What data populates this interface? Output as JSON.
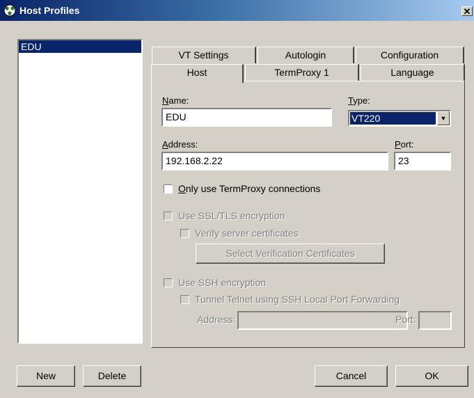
{
  "window": {
    "title": "Host Profiles",
    "close_glyph": "✕"
  },
  "profiles": [
    "EDU"
  ],
  "tabs": {
    "row_back": [
      "VT Settings",
      "Autologin",
      "Configuration"
    ],
    "row_front": [
      "Host",
      "TermProxy 1",
      "Language"
    ],
    "active": "Host"
  },
  "host": {
    "name_label": "Name:",
    "name_value": "EDU",
    "type_label": "Type:",
    "type_value": "VT220",
    "address_label": "Address:",
    "address_value": "192.168.2.22",
    "port_label": "Port:",
    "port_value": "23",
    "only_termproxy_label": "Only use TermProxy connections",
    "use_ssl_label": "Use SSL/TLS encryption",
    "verify_certs_label": "Verify server certificates",
    "select_certs_label": "Select Verification Certificates",
    "use_ssh_label": "Use SSH encryption",
    "tunnel_label": "Tunnel Telnet using SSH Local Port Forwarding",
    "ssh_address_label": "Address:",
    "ssh_port_label": "Port:"
  },
  "buttons": {
    "new": "New",
    "delete": "Delete",
    "cancel": "Cancel",
    "ok": "OK"
  },
  "colors": {
    "title_start": "#0a246a",
    "title_end": "#a6caf0",
    "selection": "#0a246a",
    "face": "#d4d0c8"
  }
}
